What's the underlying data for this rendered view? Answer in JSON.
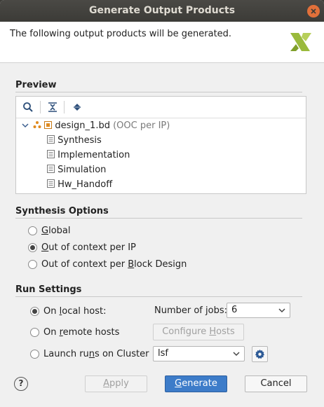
{
  "window": {
    "title": "Generate Output Products"
  },
  "header": {
    "text": "The following output products will be generated."
  },
  "preview": {
    "title": "Preview",
    "root": {
      "name": "design_1.bd",
      "suffix": "(OOC per IP)"
    },
    "children": [
      "Synthesis",
      "Implementation",
      "Simulation",
      "Hw_Handoff"
    ]
  },
  "synthesis_options": {
    "title": "Synthesis Options",
    "options": [
      {
        "pre": "",
        "u": "G",
        "post": "lobal",
        "checked": false
      },
      {
        "pre": "",
        "u": "O",
        "post": "ut of context per IP",
        "checked": true
      },
      {
        "pre": "Out of context per ",
        "u": "B",
        "post": "lock Design",
        "checked": false
      }
    ]
  },
  "run_settings": {
    "title": "Run Settings",
    "local": {
      "pre": "On ",
      "u": "l",
      "post": "ocal host:",
      "checked": true
    },
    "remote": {
      "pre": "On ",
      "u": "r",
      "post": "emote hosts",
      "checked": false
    },
    "cluster": {
      "pre": "Launch ru",
      "u": "n",
      "post": "s on Cluster",
      "checked": false
    },
    "jobs_label": {
      "pre": "Number of ",
      "u": "j",
      "post": "obs:"
    },
    "jobs_value": "6",
    "configure_hosts": {
      "pre": "Configure ",
      "u": "H",
      "post": "osts"
    },
    "cluster_value": "lsf"
  },
  "buttons": {
    "help": "?",
    "apply": {
      "pre": "",
      "u": "A",
      "post": "pply"
    },
    "generate": {
      "pre": "",
      "u": "G",
      "post": "enerate"
    },
    "cancel": "Cancel"
  }
}
